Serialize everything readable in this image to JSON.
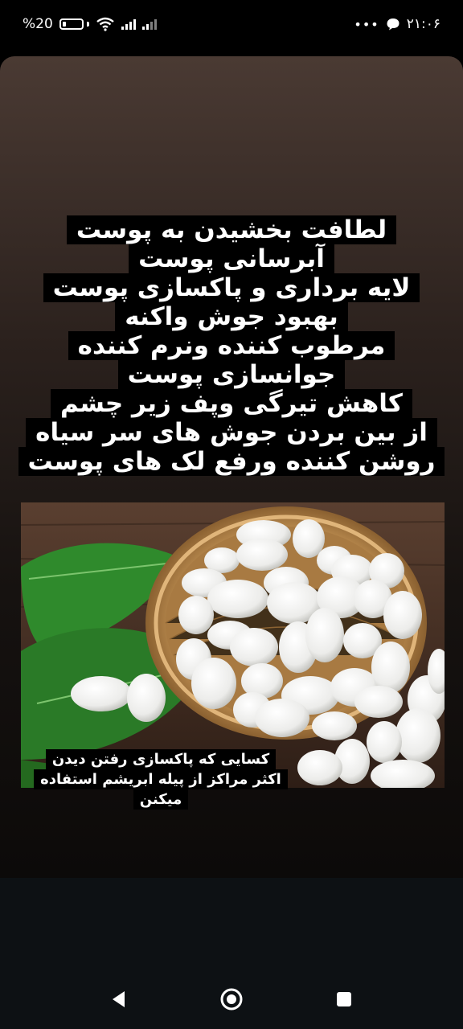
{
  "status_bar": {
    "battery": "%20",
    "battery_level": 0.2,
    "time": "۲۱:۰۶",
    "overflow": "•••"
  },
  "story": {
    "lines": [
      "لطافت بخشیدن به پوست",
      "آبرسانی پوست",
      "لایه برداری و پاکسازی پوست",
      "بهبود جوش واکنه",
      "مرطوب کننده ونرم کننده",
      "جوانسازی پوست",
      "کاهش تیرگی وپف زیر چشم",
      "از بین بردن جوش های سر سیاه",
      "روشن کننده ورفع لک های پوست"
    ],
    "caption_lines": [
      "کسایی که پاکسازی رفتن دیدن",
      "اکثر مراکز از پیله ابریشم استفاده",
      "میکنن"
    ]
  },
  "icons": {
    "wifi": "wifi-icon",
    "signal": "signal-icon",
    "battery": "battery-icon",
    "message": "message-icon",
    "back": "back-icon",
    "home": "home-icon",
    "recents": "recents-icon"
  }
}
